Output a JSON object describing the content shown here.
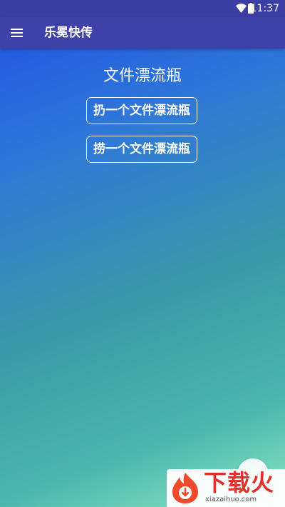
{
  "status_bar": {
    "time": "11:37"
  },
  "app_bar": {
    "title": "乐冕快传",
    "menu_icon": "hamburger-menu-icon"
  },
  "main": {
    "heading": "文件漂流瓶",
    "throw_label": "扔一个文件漂流瓶",
    "pick_label": "捞一个文件漂流瓶"
  },
  "watermark": {
    "text": "下载火",
    "url": "xiazaihuo.com"
  },
  "colors": {
    "app_bar": "#3d41a8",
    "status_bar": "#3b3fa3",
    "gradient_top": "#1f50e6",
    "gradient_bottom": "#8ee6c6",
    "watermark_red": "#e2302a"
  }
}
